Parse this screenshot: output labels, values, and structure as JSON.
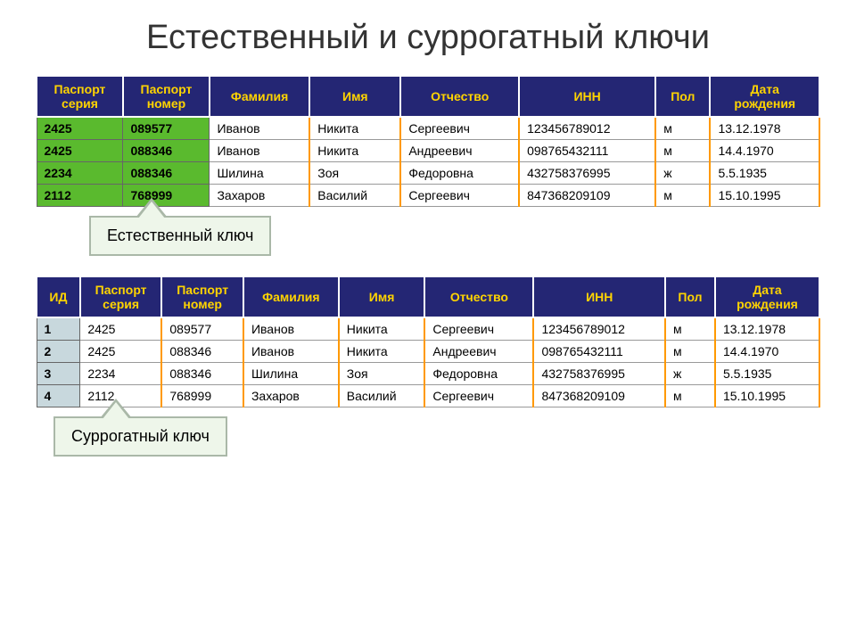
{
  "title": "Естественный и суррогатный ключи",
  "table1": {
    "headers": [
      "Паспорт серия",
      "Паспорт номер",
      "Фамилия",
      "Имя",
      "Отчество",
      "ИНН",
      "Пол",
      "Дата рождения"
    ],
    "rows": [
      [
        "2425",
        "089577",
        "Иванов",
        "Никита",
        "Сергеевич",
        "123456789012",
        "м",
        "13.12.1978"
      ],
      [
        "2425",
        "088346",
        "Иванов",
        "Никита",
        "Андреевич",
        "098765432111",
        "м",
        "14.4.1970"
      ],
      [
        "2234",
        "088346",
        "Шилина",
        "Зоя",
        "Федоровна",
        "432758376995",
        "ж",
        "5.5.1935"
      ],
      [
        "2112",
        "768999",
        "Захаров",
        "Василий",
        "Сергеевич",
        "847368209109",
        "м",
        "15.10.1995"
      ]
    ],
    "callout": "Естественный ключ"
  },
  "table2": {
    "headers": [
      "ИД",
      "Паспорт серия",
      "Паспорт номер",
      "Фамилия",
      "Имя",
      "Отчество",
      "ИНН",
      "Пол",
      "Дата рождения"
    ],
    "rows": [
      [
        "1",
        "2425",
        "089577",
        "Иванов",
        "Никита",
        "Сергеевич",
        "123456789012",
        "м",
        "13.12.1978"
      ],
      [
        "2",
        "2425",
        "088346",
        "Иванов",
        "Никита",
        "Андреевич",
        "098765432111",
        "м",
        "14.4.1970"
      ],
      [
        "3",
        "2234",
        "088346",
        "Шилина",
        "Зоя",
        "Федоровна",
        "432758376995",
        "ж",
        "5.5.1935"
      ],
      [
        "4",
        "2112",
        "768999",
        "Захаров",
        "Василий",
        "Сергеевич",
        "847368209109",
        "м",
        "15.10.1995"
      ]
    ],
    "callout": "Суррогатный ключ"
  }
}
